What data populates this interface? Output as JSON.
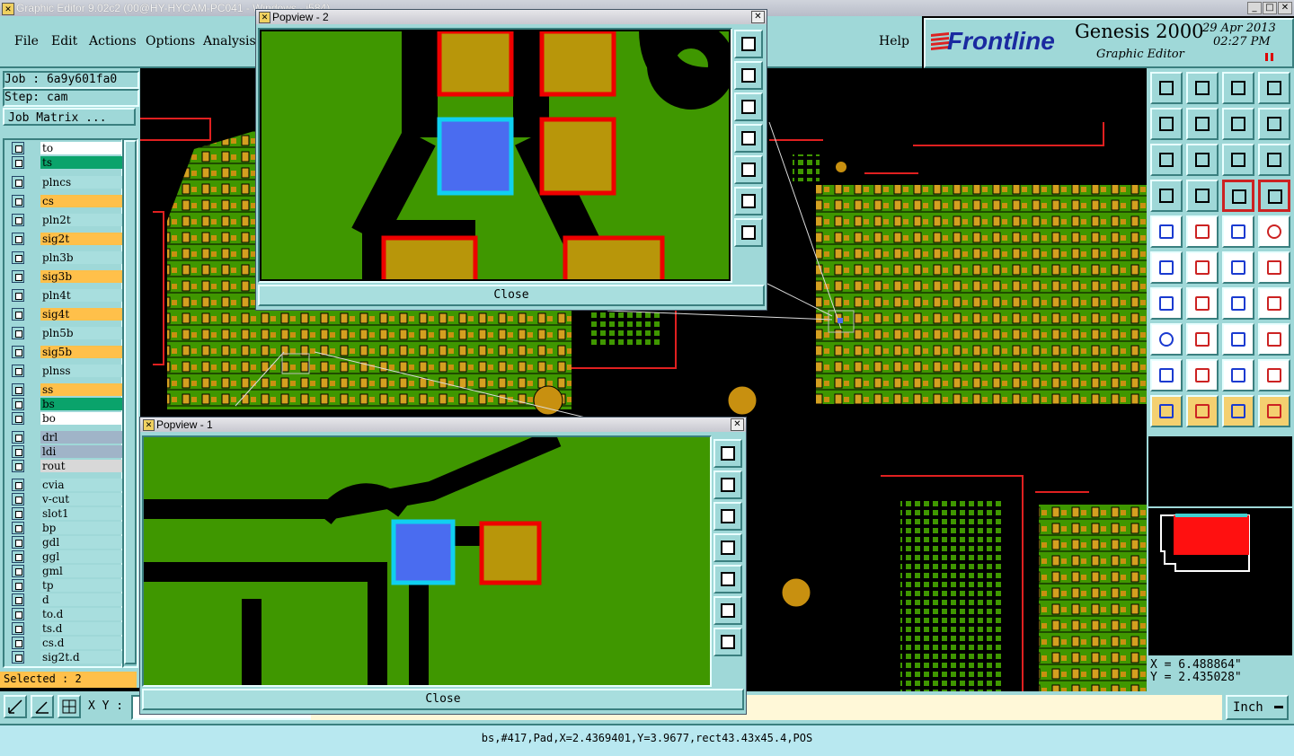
{
  "window": {
    "title": "Graphic Editor 9.02c2 (00@HY-HYCAM-PC041 - Windows - i584)"
  },
  "menu": {
    "items": [
      "File",
      "Edit",
      "Actions",
      "Options",
      "Analysis",
      "Help"
    ]
  },
  "brand": {
    "logo": "Frontline",
    "product": "Genesis 2000",
    "subtitle": "Graphic Editor",
    "date": "29 Apr 2013",
    "time": "02:27 PM"
  },
  "job": {
    "job_label": "Job : 6a9y601fa0",
    "step_label": "Step: cam",
    "matrix_button": "Job Matrix ..."
  },
  "layers": [
    {
      "name": "to",
      "color": "#ffffff"
    },
    {
      "name": "ts",
      "color": "#0aa36b"
    },
    {
      "name": "plncs",
      "color": "#a8dede"
    },
    {
      "name": "cs",
      "color": "#ffc04a"
    },
    {
      "name": "pln2t",
      "color": "#a8dede"
    },
    {
      "name": "sig2t",
      "color": "#ffc04a"
    },
    {
      "name": "pln3b",
      "color": "#a8dede"
    },
    {
      "name": "sig3b",
      "color": "#ffc04a"
    },
    {
      "name": "pln4t",
      "color": "#a8dede"
    },
    {
      "name": "sig4t",
      "color": "#ffc04a"
    },
    {
      "name": "pln5b",
      "color": "#a8dede"
    },
    {
      "name": "sig5b",
      "color": "#ffc04a"
    },
    {
      "name": "plnss",
      "color": "#a8dede"
    },
    {
      "name": "ss",
      "color": "#ffc04a"
    },
    {
      "name": "bs",
      "color": "#0aa36b"
    },
    {
      "name": "bo",
      "color": "#ffffff"
    },
    {
      "name": "drl",
      "color": "#a0b4c8"
    },
    {
      "name": "ldi",
      "color": "#a0b4c8"
    },
    {
      "name": "rout",
      "color": "#d8d8d8"
    },
    {
      "name": "cvia",
      "color": "#a8dede"
    },
    {
      "name": "v-cut",
      "color": "#a8dede"
    },
    {
      "name": "slot1",
      "color": "#a8dede"
    },
    {
      "name": "bp",
      "color": "#a8dede"
    },
    {
      "name": "gdl",
      "color": "#a8dede"
    },
    {
      "name": "ggl",
      "color": "#a8dede"
    },
    {
      "name": "gml",
      "color": "#a8dede"
    },
    {
      "name": "tp",
      "color": "#a8dede"
    },
    {
      "name": "d",
      "color": "#a8dede"
    },
    {
      "name": "to.d",
      "color": "#a8dede"
    },
    {
      "name": "ts.d",
      "color": "#a8dede"
    },
    {
      "name": "cs.d",
      "color": "#a8dede"
    },
    {
      "name": "sig2t.d",
      "color": "#a8dede"
    }
  ],
  "selected_label": "Selected : 2",
  "popview2": {
    "title": "Popview - 2",
    "close_label": "Close"
  },
  "popview1": {
    "title": "Popview - 1",
    "close_label": "Close"
  },
  "coords": {
    "x": "X = 6.488864\"",
    "y": "Y = 2.435028\""
  },
  "bottom": {
    "xy_label": "X Y :",
    "units": "Inch"
  },
  "status": "bs,#417,Pad,X=2.4369401,Y=3.9677,rect43.43x45.4,POS",
  "colors": {
    "panel": "#9fd8d8",
    "copper": "#3f9700",
    "pad": "#b8960a",
    "selected": "#4a6cf0",
    "outline": "#ff2020"
  }
}
